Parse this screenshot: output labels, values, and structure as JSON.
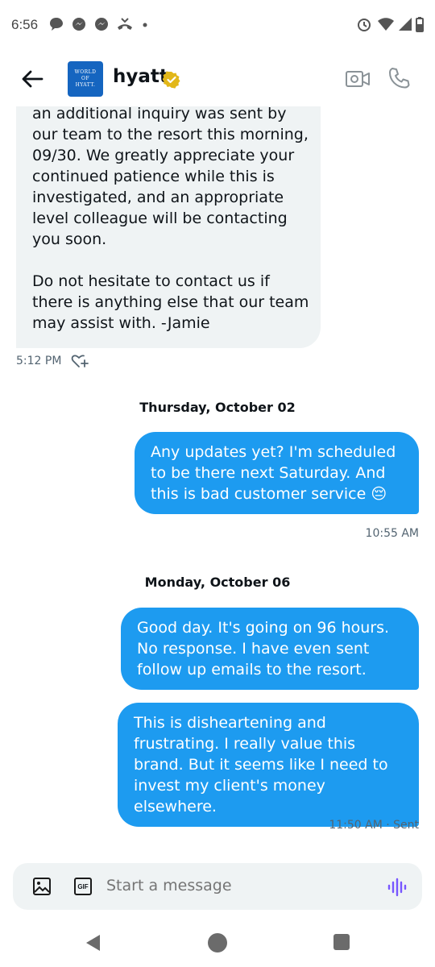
{
  "status_bar": {
    "time": "6:56",
    "icons": [
      "chat-bubble-icon",
      "messenger-icon",
      "messenger-icon",
      "missed-call-icon",
      "dot-icon",
      "alarm-icon",
      "wifi-icon",
      "signal-icon",
      "battery-icon"
    ]
  },
  "header": {
    "logo_lines": [
      "WORLD",
      "OF",
      "HYATT."
    ],
    "title": "hyatt",
    "verified_icon": "verified-badge-icon",
    "video_icon": "video-call-icon",
    "call_icon": "phone-icon",
    "back_icon": "back-arrow-icon"
  },
  "incoming": {
    "paragraph_1": "an additional inquiry was sent by our team to the resort this morning, 09/30. We greatly appreciate your continued patience while this is investigated, and an appropriate level colleague will be contacting you soon.",
    "paragraph_2": "Do not hesitate to contact us if there is anything else that our team may assist with. -Jamie",
    "time": "5:12 PM",
    "react_icon": "add-reaction-icon"
  },
  "thread": {
    "date_1": "Thursday, October 02",
    "msg_1": "Any updates yet? I'm scheduled to be there next Saturday. And this is bad customer service 😔",
    "msg_1_time": "10:55 AM",
    "date_2": "Monday, October 06",
    "msg_2": "Good day. It's going on 96 hours. No response. I have even sent follow up emails to the resort.",
    "msg_3": "This is disheartening and frustrating. I really value this brand. But it seems like I need to invest my client's money elsewhere.",
    "msg_3_time": "11:50 AM · Sent"
  },
  "composer": {
    "placeholder": "Start a message",
    "image_icon": "image-icon",
    "gif_label": "GIF",
    "voice_icon": "voice-message-icon"
  },
  "colors": {
    "accent": "#1d9bf0",
    "incoming_bg": "#eff3f4",
    "voice": "#7856ff",
    "verified": "#e2b719"
  }
}
